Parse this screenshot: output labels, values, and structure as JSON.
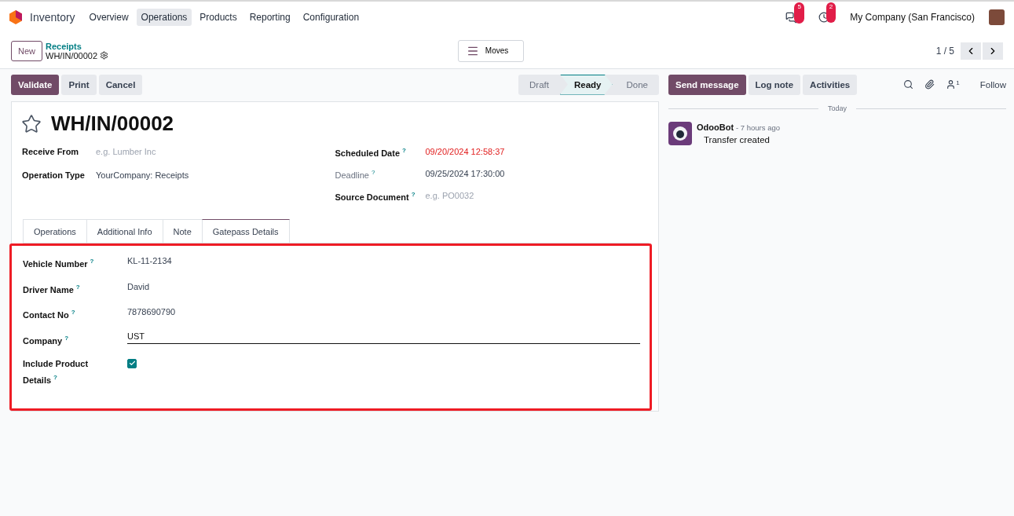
{
  "navbar": {
    "app": "Inventory",
    "menu": [
      {
        "label": "Overview",
        "selected": false
      },
      {
        "label": "Operations",
        "selected": true
      },
      {
        "label": "Products",
        "selected": false
      },
      {
        "label": "Reporting",
        "selected": false
      },
      {
        "label": "Configuration",
        "selected": false
      }
    ],
    "messages_badge": "5",
    "activities_badge": "2",
    "company": "My Company (San Francisco)"
  },
  "control_panel": {
    "new_button": "New",
    "breadcrumb": "Receipts",
    "record": "WH/IN/00002",
    "moves_button": "Moves",
    "pager": "1 / 5"
  },
  "actions": [
    {
      "label": "Validate",
      "kind": "primary"
    },
    {
      "label": "Print",
      "kind": "secondary"
    },
    {
      "label": "Cancel",
      "kind": "secondary"
    }
  ],
  "statusbar": [
    {
      "label": "Draft",
      "selected": false
    },
    {
      "label": "Ready",
      "selected": true
    },
    {
      "label": "Done",
      "selected": false
    }
  ],
  "form": {
    "title": "WH/IN/00002",
    "starred": false,
    "left_fields": [
      {
        "label": "Receive From",
        "placeholder": "e.g. Lumber Inc"
      },
      {
        "label": "Operation Type",
        "value": "YourCompany: Receipts"
      }
    ],
    "right_fields": [
      {
        "label": "Scheduled Date",
        "tip": "?",
        "value": "09/20/2024 12:58:37",
        "overdue": true,
        "muted_label": false
      },
      {
        "label": "Deadline",
        "tip": "?",
        "value": "09/25/2024 17:30:00",
        "overdue": false,
        "muted_label": true
      },
      {
        "label": "Source Document",
        "tip": "?",
        "placeholder": "e.g. PO0032",
        "muted_label": false
      }
    ],
    "tabs": [
      {
        "label": "Operations",
        "selected": false
      },
      {
        "label": "Additional Info",
        "selected": false
      },
      {
        "label": "Note",
        "selected": false
      },
      {
        "label": "Gatepass Details",
        "selected": true
      }
    ],
    "panel_highlighted": true,
    "gatepass": [
      {
        "kind": "text",
        "label": "Vehicle Number",
        "tip": "?",
        "value": "KL-11-2134"
      },
      {
        "kind": "text",
        "label": "Driver Name",
        "tip": "?",
        "value": "David"
      },
      {
        "kind": "text",
        "label": "Contact No",
        "tip": "?",
        "value": "7878690790"
      },
      {
        "kind": "input",
        "label": "Company",
        "tip": "?",
        "value": "UST"
      },
      {
        "kind": "checkbox",
        "label": "Include Product Details",
        "tip": "?",
        "checked": true
      }
    ]
  },
  "chatter": {
    "buttons": [
      {
        "label": "Send message",
        "kind": "primary"
      },
      {
        "label": "Log note",
        "kind": "secondary"
      },
      {
        "label": "Activities",
        "kind": "secondary"
      }
    ],
    "followers": "1",
    "follow": "Follow",
    "divider": "Today",
    "messages": [
      {
        "author": "OdooBot",
        "time": "- 7 hours ago",
        "body": "Transfer created"
      }
    ]
  }
}
